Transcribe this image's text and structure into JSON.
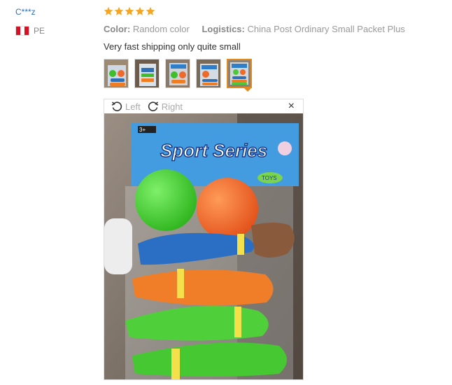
{
  "reviewer": {
    "name": "C***z",
    "country": "PE",
    "flag_colors": [
      "#d91023",
      "#ffffff",
      "#d91023"
    ]
  },
  "rating": {
    "stars": 5,
    "max": 5,
    "color": "#f5a623"
  },
  "meta": {
    "color_label": "Color:",
    "color_value": "Random color",
    "logistics_label": "Logistics:",
    "logistics_value": "China Post Ordinary Small Packet Plus"
  },
  "review": {
    "text": "Very fast shipping only quite small"
  },
  "thumbnails": {
    "count": 5,
    "selected_index": 4
  },
  "viewer": {
    "rotate_left": "Left",
    "rotate_right": "Right",
    "close": "×"
  },
  "photo": {
    "package_label": "Sport Series",
    "brand_tag": "TOYS"
  }
}
